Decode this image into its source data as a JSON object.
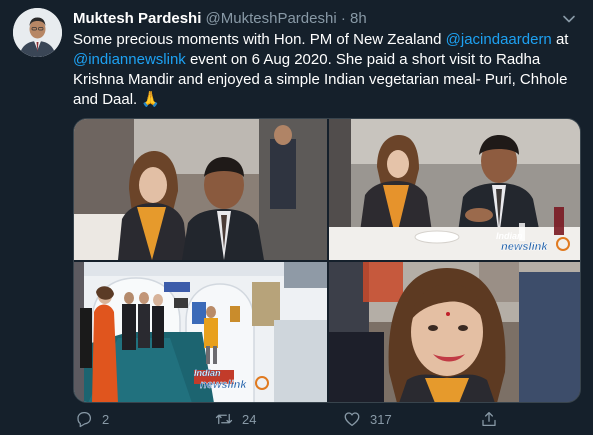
{
  "tweet": {
    "display_name": "Muktesh Pardeshi",
    "handle": "@MukteshPardeshi",
    "separator": "·",
    "time": "8h",
    "text": {
      "part1": "Some precious moments with Hon. PM of New Zealand ",
      "mention1": "@jacindaardern",
      "part2": " at ",
      "mention2": "@indiannewslink",
      "part3": "  event on 6 Aug 2020. She paid a short visit to Radha Krishna Mandir and enjoyed a simple Indian vegetarian meal- Puri, Chhole and Daal. ",
      "emoji": "🙏"
    },
    "media": {
      "watermark": "indian newslink",
      "watermark_parts": [
        "Indian",
        "newslink"
      ]
    },
    "actions": {
      "reply_count": "2",
      "retweet_count": "24",
      "like_count": "317"
    }
  },
  "icons": {
    "caret": "chevron-down-icon",
    "reply": "reply-icon",
    "retweet": "retweet-icon",
    "like": "heart-icon",
    "share": "share-icon"
  },
  "colors": {
    "background": "#15202b",
    "accent": "#1da1f2",
    "secondary_text": "#8899a6",
    "border": "#38444d"
  }
}
